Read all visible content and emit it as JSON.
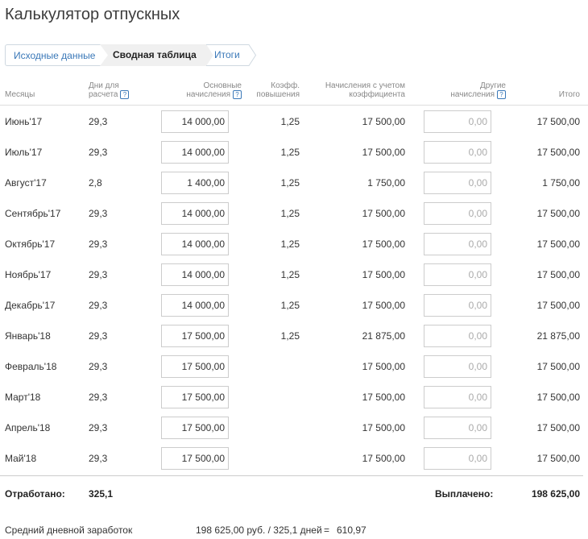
{
  "page_title": "Калькулятор отпускных",
  "steps": [
    {
      "label": "Исходные данные"
    },
    {
      "label": "Сводная таблица"
    },
    {
      "label": "Итоги"
    }
  ],
  "columns": {
    "month": "Месяцы",
    "days_1": "Дни для",
    "days_2": "расчета",
    "base_1": "Основные",
    "base_2": "начисления",
    "coef_1": "Коэфф.",
    "coef_2": "повышения",
    "accr_1": "Начисления с учетом",
    "accr_2": "коэффициента",
    "other_1": "Другие",
    "other_2": "начисления",
    "total": "Итого",
    "help_glyph": "?"
  },
  "rows": [
    {
      "month": "Июнь'17",
      "days": "29,3",
      "base": "14 000,00",
      "coef": "1,25",
      "accr": "17 500,00",
      "other": "0,00",
      "total": "17 500,00"
    },
    {
      "month": "Июль'17",
      "days": "29,3",
      "base": "14 000,00",
      "coef": "1,25",
      "accr": "17 500,00",
      "other": "0,00",
      "total": "17 500,00"
    },
    {
      "month": "Август'17",
      "days": "2,8",
      "base": "1 400,00",
      "coef": "1,25",
      "accr": "1 750,00",
      "other": "0,00",
      "total": "1 750,00"
    },
    {
      "month": "Сентябрь'17",
      "days": "29,3",
      "base": "14 000,00",
      "coef": "1,25",
      "accr": "17 500,00",
      "other": "0,00",
      "total": "17 500,00"
    },
    {
      "month": "Октябрь'17",
      "days": "29,3",
      "base": "14 000,00",
      "coef": "1,25",
      "accr": "17 500,00",
      "other": "0,00",
      "total": "17 500,00"
    },
    {
      "month": "Ноябрь'17",
      "days": "29,3",
      "base": "14 000,00",
      "coef": "1,25",
      "accr": "17 500,00",
      "other": "0,00",
      "total": "17 500,00"
    },
    {
      "month": "Декабрь'17",
      "days": "29,3",
      "base": "14 000,00",
      "coef": "1,25",
      "accr": "17 500,00",
      "other": "0,00",
      "total": "17 500,00"
    },
    {
      "month": "Январь'18",
      "days": "29,3",
      "base": "17 500,00",
      "coef": "1,25",
      "accr": "21 875,00",
      "other": "0,00",
      "total": "21 875,00"
    },
    {
      "month": "Февраль'18",
      "days": "29,3",
      "base": "17 500,00",
      "coef": "",
      "accr": "17 500,00",
      "other": "0,00",
      "total": "17 500,00"
    },
    {
      "month": "Март'18",
      "days": "29,3",
      "base": "17 500,00",
      "coef": "",
      "accr": "17 500,00",
      "other": "0,00",
      "total": "17 500,00"
    },
    {
      "month": "Апрель'18",
      "days": "29,3",
      "base": "17 500,00",
      "coef": "",
      "accr": "17 500,00",
      "other": "0,00",
      "total": "17 500,00"
    },
    {
      "month": "Май'18",
      "days": "29,3",
      "base": "17 500,00",
      "coef": "",
      "accr": "17 500,00",
      "other": "0,00",
      "total": "17 500,00"
    }
  ],
  "summary": {
    "worked_label": "Отработано:",
    "worked_value": "325,1",
    "paid_label": "Выплачено:",
    "paid_value": "198 625,00"
  },
  "average": {
    "label": "Средний дневной заработок",
    "formula": "198 625,00 руб. / 325,1 дней",
    "equals": "=",
    "result": "610,97"
  },
  "colors": {
    "link": "#3a78b8",
    "border": "#cccccc",
    "active_step_bg": "#f0f0f0"
  }
}
